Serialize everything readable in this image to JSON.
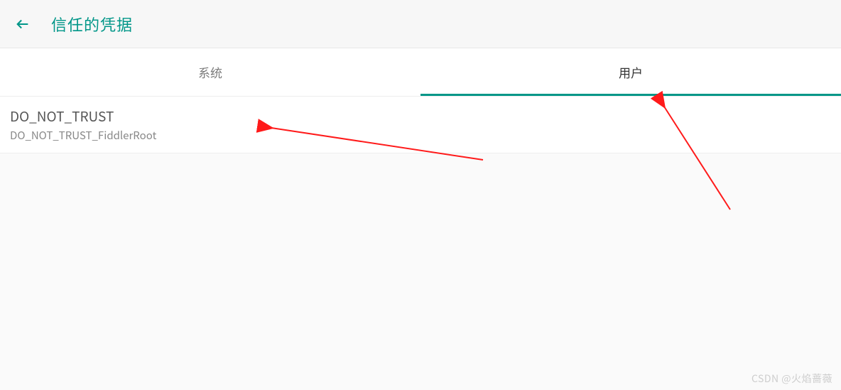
{
  "header": {
    "title": "信任的凭据"
  },
  "tabs": {
    "system": "系统",
    "user": "用户",
    "active_index": 1
  },
  "list": {
    "items": [
      {
        "title": "DO_NOT_TRUST",
        "subtitle": "DO_NOT_TRUST_FiddlerRoot"
      }
    ]
  },
  "watermark": "CSDN @火焰蔷薇",
  "colors": {
    "accent": "#009688",
    "annotation": "#ff1a1a"
  }
}
